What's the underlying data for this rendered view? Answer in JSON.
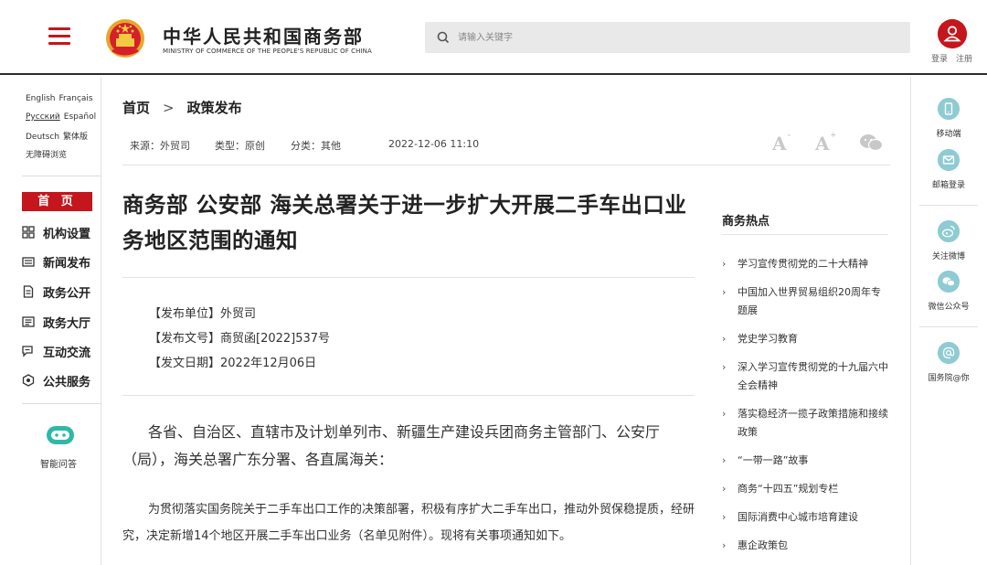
{
  "header": {
    "site_title": "中华人民共和国商务部",
    "site_subtitle": "MINISTRY OF COMMERCE OF THE PEOPLE'S REPUBLIC OF CHINA",
    "search_placeholder": "请输入关键字",
    "login_label": "登录",
    "register_label": "注册",
    "brand_color": "#c4161c"
  },
  "languages": {
    "row1": [
      "English",
      "Français"
    ],
    "row2": [
      "Русский",
      "Español"
    ],
    "row3": [
      "Deutsch",
      "繁体版"
    ],
    "accessibility": "无障碍浏览"
  },
  "nav": {
    "home": "首 页",
    "items": [
      {
        "label": "机构设置",
        "icon": "org-grid-icon"
      },
      {
        "label": "新闻发布",
        "icon": "news-icon"
      },
      {
        "label": "政务公开",
        "icon": "document-icon"
      },
      {
        "label": "政务大厅",
        "icon": "hall-icon"
      },
      {
        "label": "互动交流",
        "icon": "chat-icon"
      },
      {
        "label": "公共服务",
        "icon": "service-icon"
      }
    ],
    "ai_label": "智能问答"
  },
  "breadcrumb": {
    "home": "首页",
    "arrow": ">",
    "current": "政策发布"
  },
  "meta": {
    "source": "来源：外贸司",
    "type": "类型：原创",
    "category": "分类：其他",
    "date": "2022-12-06 11:10"
  },
  "article": {
    "title": "商务部 公安部 海关总署关于进一步扩大开展二手车出口业务地区范围的通知",
    "issuer": "【发布单位】外贸司",
    "doc_number": "【发布文号】商贸函[2022]537号",
    "issue_date": "【发文日期】2022年12月06日",
    "salutation": "各省、自治区、直辖市及计划单列市、新疆生产建设兵团商务主管部门、公安厅（局），海关总署广东分署、各直属海关：",
    "paragraph1": "为贯彻落实国务院关于二手车出口工作的决策部署，积极有序扩大二手车出口，推动外贸保稳提质，经研究，决定新增14个地区开展二手车出口业务（名单见附件）。现将有关事项通知如下。"
  },
  "hot": {
    "title": "商务热点",
    "items": [
      "学习宣传贯彻党的二十大精神",
      "中国加入世界贸易组织20周年专题展",
      "党史学习教育",
      "深入学习宣传贯彻党的十九届六中全会精神",
      "落实稳经济一揽子政策措施和接续政策",
      "“一带一路”故事",
      "商务“十四五”规划专栏",
      "国际消费中心城市培育建设",
      "惠企政策包"
    ]
  },
  "right_sidebar": {
    "items": [
      {
        "label": "移动端",
        "icon": "mobile-icon"
      },
      {
        "label": "邮箱登录",
        "icon": "mail-icon"
      },
      {
        "label": "关注微博",
        "icon": "weibo-icon"
      },
      {
        "label": "微信公众号",
        "icon": "wechat-icon"
      },
      {
        "label": "国务院@你",
        "icon": "at-icon"
      }
    ],
    "icon_color": "#8ecbd3"
  }
}
